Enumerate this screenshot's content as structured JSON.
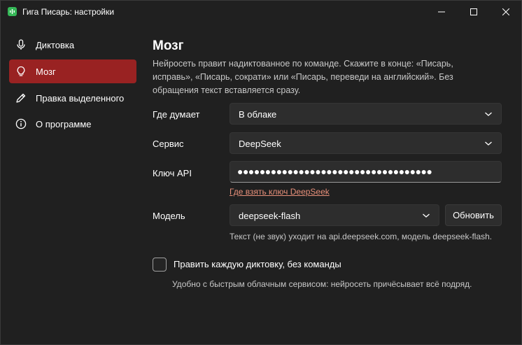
{
  "window": {
    "title": "Гига Писарь: настройки"
  },
  "sidebar": {
    "items": [
      {
        "label": "Диктовка",
        "icon": "microphone-icon",
        "active": false
      },
      {
        "label": "Мозг",
        "icon": "lightbulb-icon",
        "active": true
      },
      {
        "label": "Правка выделенного",
        "icon": "pencil-icon",
        "active": false
      },
      {
        "label": "О программе",
        "icon": "info-icon",
        "active": false
      }
    ]
  },
  "main": {
    "title": "Мозг",
    "description": "Нейросеть правит надиктованное по команде. Скажите в конце: «Писарь, исправь», «Писарь, сократи» или «Писарь, переведи на английский». Без обращения текст вставляется сразу.",
    "where_thinks": {
      "label": "Где думает",
      "value": "В облаке"
    },
    "service": {
      "label": "Сервис",
      "value": "DeepSeek"
    },
    "api_key": {
      "label": "Ключ API",
      "value": "●●●●●●●●●●●●●●●●●●●●●●●●●●●●●●●●●●●"
    },
    "api_key_link": "Где взять ключ DeepSeek",
    "model": {
      "label": "Модель",
      "value": "deepseek-flash"
    },
    "refresh_button": "Обновить",
    "model_note": "Текст (не звук) уходит на api.deepseek.com, модель deepseek-flash.",
    "auto_edit": {
      "label": "Править каждую диктовку, без команды",
      "checked": false,
      "note": "Удобно с быстрым облачным сервисом: нейросеть причёсывает всё подряд."
    }
  },
  "colors": {
    "background": "#202020",
    "active_nav": "#992222",
    "link": "#e8907a",
    "app_icon": "#35b857"
  }
}
